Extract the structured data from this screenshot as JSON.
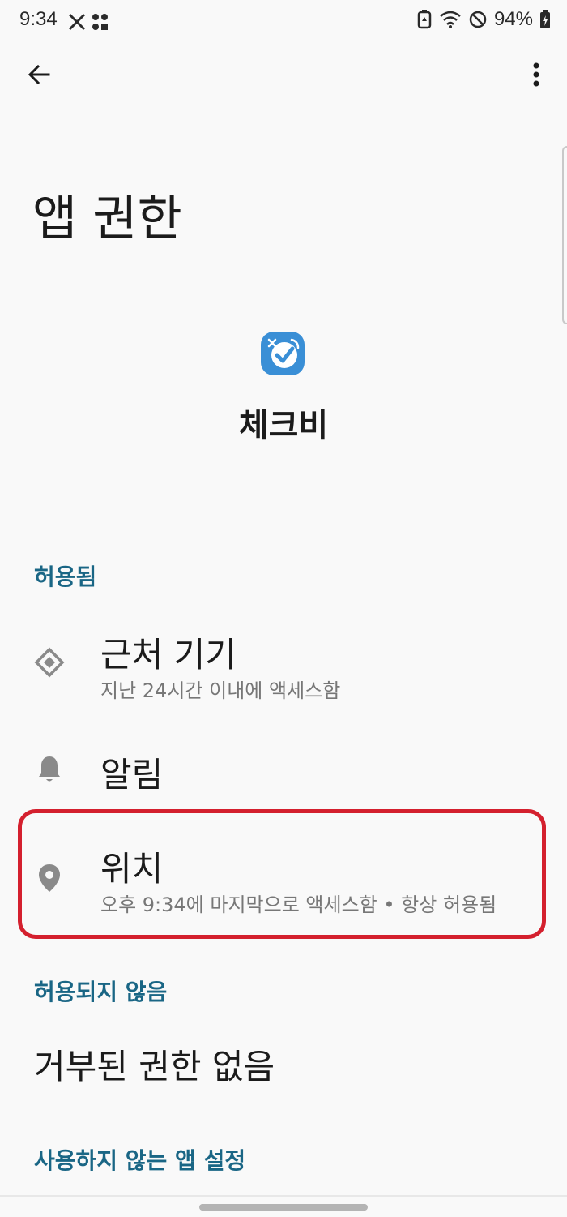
{
  "status_bar": {
    "time": "9:34",
    "battery": "94%"
  },
  "toolbar": {
    "back_icon": "arrow-left-icon",
    "more_icon": "more-vertical-icon"
  },
  "page": {
    "title": "앱 권한"
  },
  "app": {
    "name": "체크비",
    "icon_color": "#3a8fd6"
  },
  "sections": {
    "allowed": {
      "header": "허용됨",
      "items": [
        {
          "title": "근처 기기",
          "subtitle": "지난 24시간 이내에 액세스함",
          "icon": "nearby-devices-icon"
        },
        {
          "title": "알림",
          "subtitle": "",
          "icon": "bell-icon"
        },
        {
          "title": "위치",
          "subtitle": "오후 9:34에 마지막으로 액세스함 • 항상 허용됨",
          "icon": "location-pin-icon"
        }
      ]
    },
    "not_allowed": {
      "header": "허용되지 않음",
      "empty_text": "거부된 권한 없음"
    },
    "unused": {
      "header": "사용하지 않는 앱 설정"
    }
  },
  "colors": {
    "accent": "#1a6685",
    "highlight": "#d4202e",
    "background": "#f9f9f9"
  }
}
